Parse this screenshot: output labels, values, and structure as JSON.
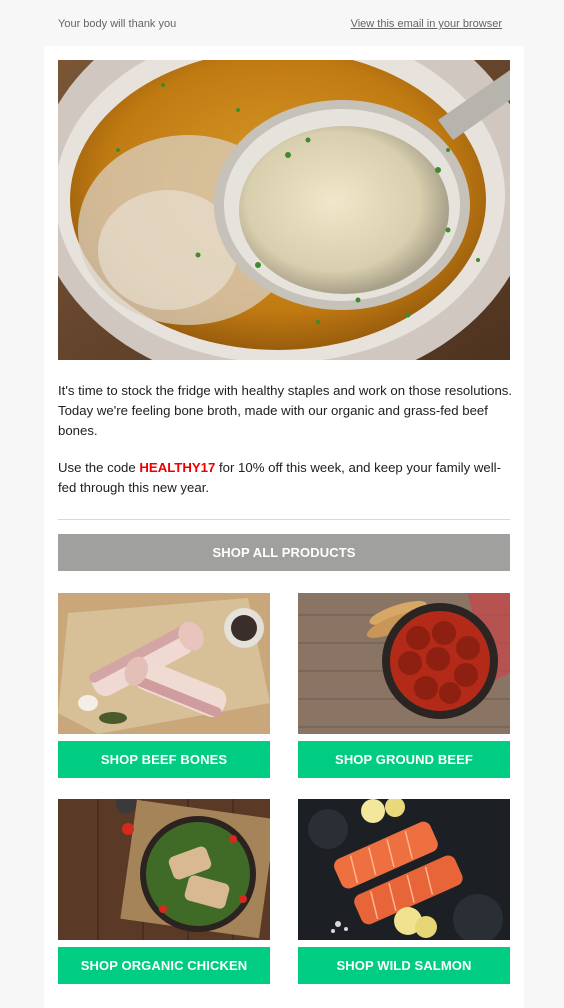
{
  "preheader": {
    "tagline": "Your body will thank you",
    "browser_link": "View this email in your browser"
  },
  "hero": {
    "image": "bone-broth-pot-with-ladle"
  },
  "intro": {
    "paragraph1": "It's time to stock the fridge with healthy staples and work on those resolutions. Today we're feeling bone broth, made with our organic and grass-fed beef bones.",
    "paragraph2_before": "Use the code ",
    "promo_code": "HEALTHY17",
    "paragraph2_after": " for 10% off this week, and keep your family well-fed through this new year."
  },
  "cta_all": {
    "label": "SHOP ALL PRODUCTS"
  },
  "products": [
    {
      "image": "beef-marrow-bones",
      "button_label": "SHOP BEEF BONES"
    },
    {
      "image": "meatballs-in-tomato-sauce",
      "button_label": "SHOP GROUND BEEF"
    },
    {
      "image": "grilled-chicken-salad",
      "button_label": "SHOP ORGANIC CHICKEN"
    },
    {
      "image": "raw-salmon-fillets",
      "button_label": "SHOP WILD SALMON"
    }
  ],
  "colors": {
    "page_background": "#f7f7f7",
    "card_background": "#ffffff",
    "promo_code": "#ee0000",
    "primary_button": "#a0a09e",
    "product_button": "#00cc82"
  }
}
